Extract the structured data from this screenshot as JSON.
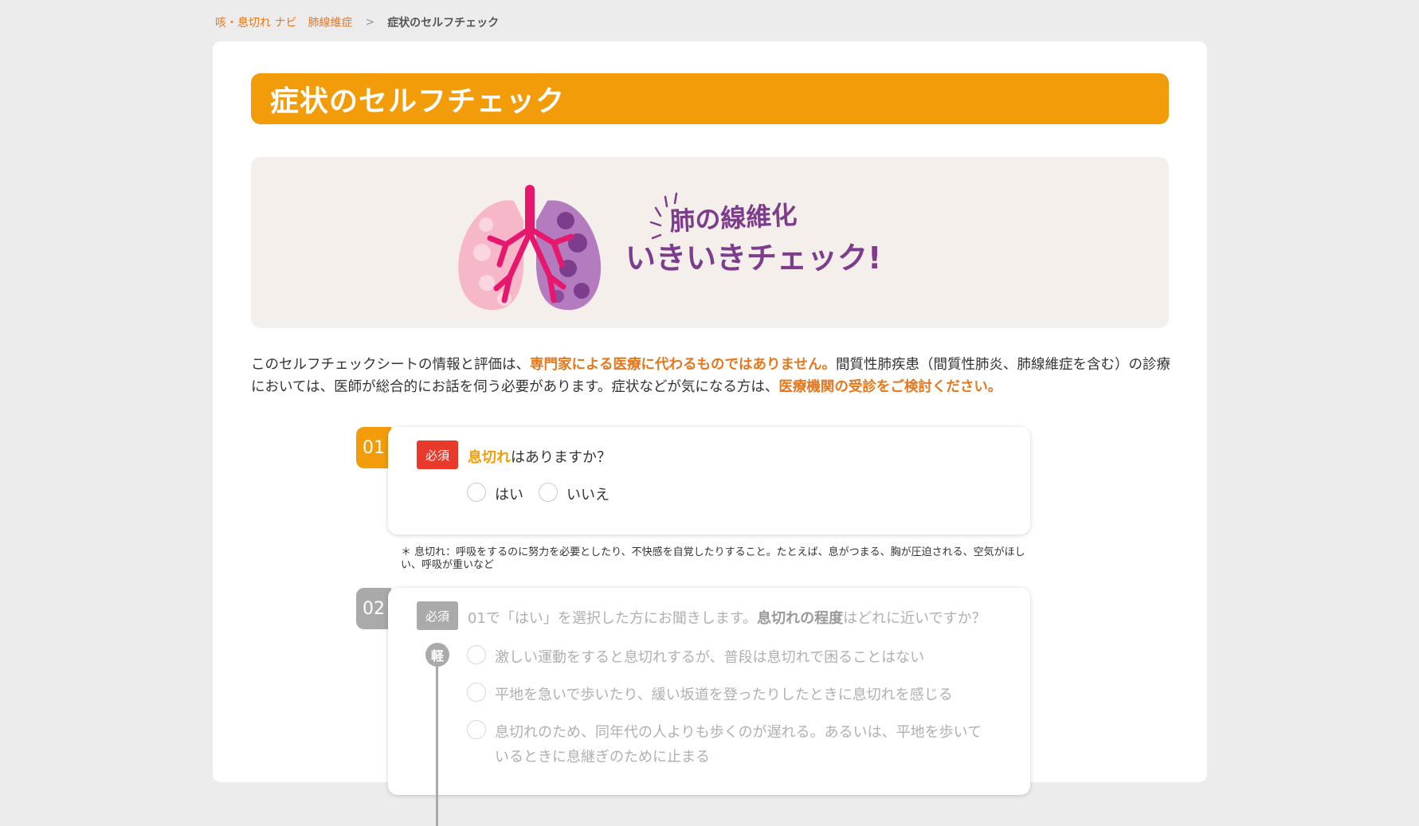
{
  "breadcrumb": {
    "home": "咳・息切れ ナビ　肺線維症",
    "separator": ">",
    "current": "症状のセルフチェック"
  },
  "page_title": "症状のセルフチェック",
  "banner": {
    "line1": "肺の線維化",
    "line2": "いきいきチェック!"
  },
  "intro": {
    "p1": "このセルフチェックシートの情報と評価は、",
    "hl1": "専門家による医療に代わるものではありません。",
    "p2": "間質性肺疾患（間質性肺炎、肺線維症を含む）の診療においては、医師が総合的にお話を伺う必要があります。症状などが気になる方は、",
    "hl2": "医療機関の受診をご検討ください。"
  },
  "questions": [
    {
      "number": "01",
      "badge": "必須",
      "hl": "息切れ",
      "text": "はありますか？",
      "options": [
        "はい",
        "いいえ"
      ],
      "note": "＊ 息切れ：呼吸をするのに努力を必要としたり、不快感を自覚したりすること。たとえば、息がつまる、胸が圧迫される、空気がほしい、呼吸が重いなど"
    },
    {
      "number": "02",
      "badge": "必須",
      "pre": "01で「はい」を選択した方にお聞きします。",
      "bold": "息切れの程度",
      "post": "はどれに近いですか？",
      "scale_top": "軽",
      "options": [
        "激しい運動をすると息切れするが、普段は息切れで困ることはない",
        "平地を急いで歩いたり、緩い坂道を登ったりしたときに息切れを感じる",
        "息切れのため、同年代の人よりも歩くのが遅れる。あるいは、平地を歩いて",
        "いるときに息継ぎのために止まる"
      ]
    }
  ],
  "colors": {
    "accent": "#f39c0a",
    "link": "#e5781e",
    "required": "#e8392b",
    "disabled": "#aaaaaa"
  }
}
